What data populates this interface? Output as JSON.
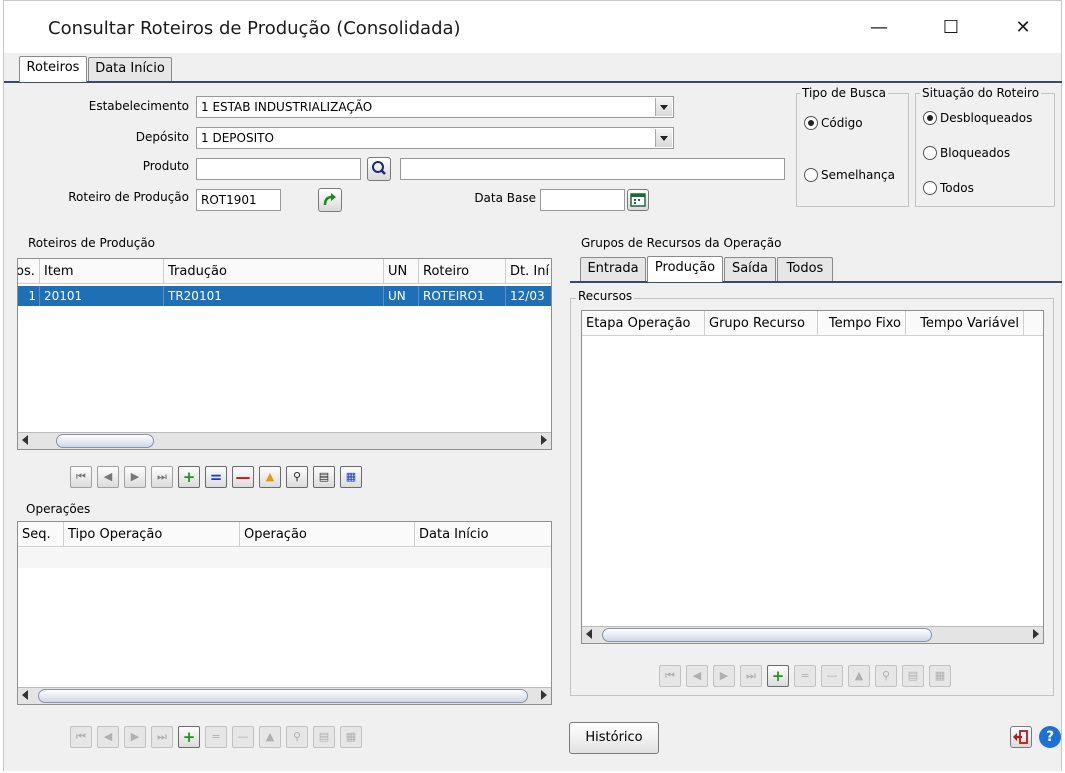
{
  "window": {
    "title": "Consultar Roteiros de Produção (Consolidada)"
  },
  "main_tabs": [
    {
      "label": "Roteiros",
      "active": true
    },
    {
      "label": "Data Início",
      "active": false
    }
  ],
  "form": {
    "estabelecimento_label": "Estabelecimento",
    "estabelecimento_value": "1 ESTAB INDUSTRIALIZAÇÃO",
    "deposito_label": "Depósito",
    "deposito_value": "1 DEPOSITO",
    "produto_label": "Produto",
    "produto_value": "",
    "produto_desc_value": "",
    "roteiro_label": "Roteiro de Produção",
    "roteiro_value": "ROT1901",
    "data_base_label": "Data Base",
    "data_base_value": ""
  },
  "tipo_busca": {
    "title": "Tipo de Busca",
    "options": [
      {
        "label": "Código",
        "checked": true
      },
      {
        "label": "Semelhança",
        "checked": false
      }
    ]
  },
  "situacao": {
    "title": "Situação do Roteiro",
    "options": [
      {
        "label": "Desbloqueados",
        "checked": true
      },
      {
        "label": "Bloqueados",
        "checked": false
      },
      {
        "label": "Todos",
        "checked": false
      }
    ]
  },
  "roteiros_grid": {
    "title": "Roteiros de Produção",
    "columns": [
      "os.",
      "Item",
      "Tradução",
      "UN",
      "Roteiro",
      "Dt. Iní"
    ],
    "rows": [
      [
        "1",
        "20101",
        "TR20101",
        "UN",
        "ROTEIRO1",
        "12/03"
      ]
    ]
  },
  "operacoes_grid": {
    "title": "Operações",
    "columns": [
      "Seq.",
      "Tipo Operação",
      "Operação",
      "Data Início"
    ]
  },
  "grupos": {
    "title": "Grupos de Recursos da Operação",
    "tabs": [
      {
        "label": "Entrada",
        "active": false
      },
      {
        "label": "Produção",
        "active": true
      },
      {
        "label": "Saída",
        "active": false
      },
      {
        "label": "Todos",
        "active": false
      }
    ],
    "recursos_title": "Recursos",
    "columns": [
      "Etapa Operação",
      "Grupo Recurso",
      "Tempo Fixo",
      "Tempo Variável"
    ]
  },
  "buttons": {
    "historico": "Histórico"
  },
  "colors": {
    "selection": "#1e6fb6",
    "tab_line": "#3a4a6a"
  }
}
